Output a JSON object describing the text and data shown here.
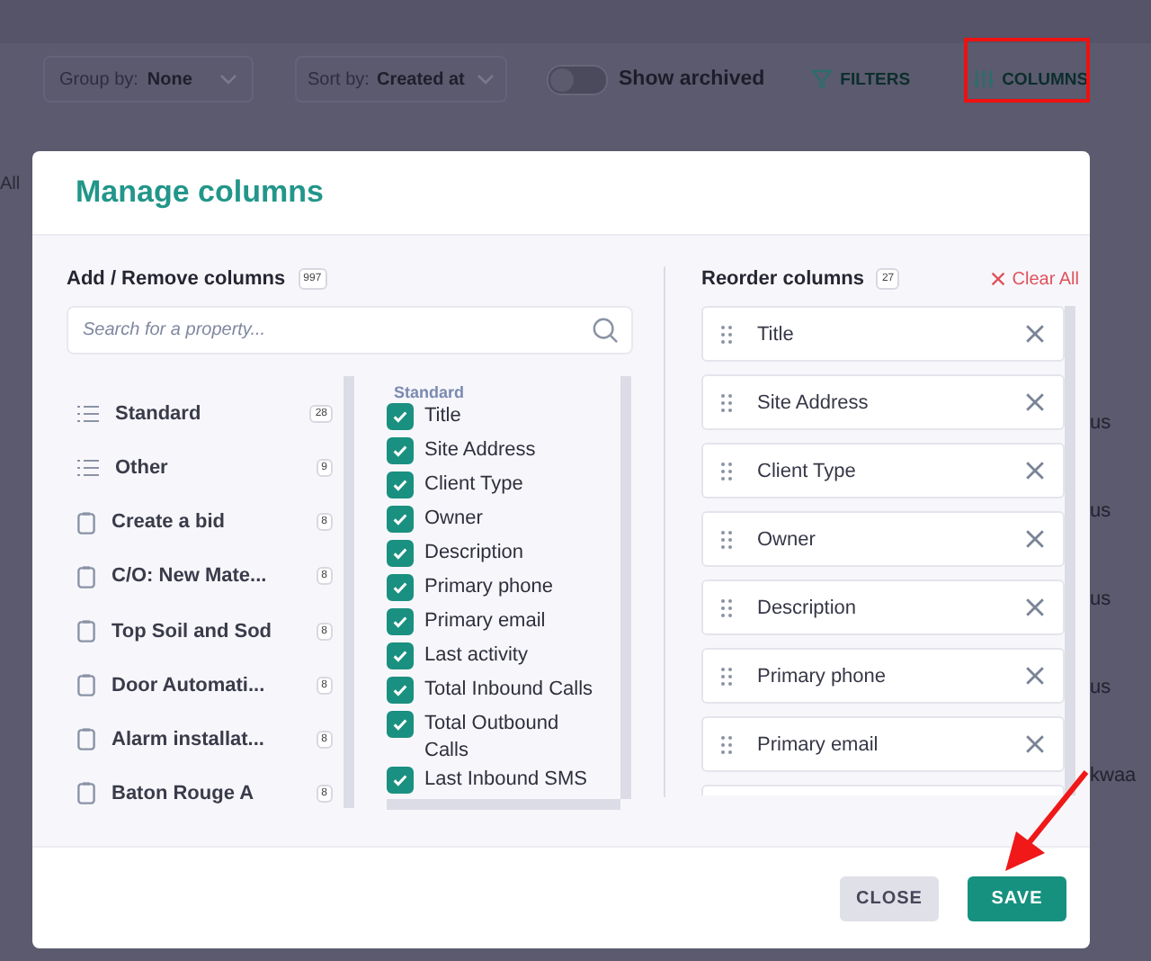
{
  "toolbar": {
    "group_by": {
      "label": "Group by:",
      "value": "None"
    },
    "sort_by": {
      "label": "Sort by:",
      "value": "Created at"
    },
    "show_archived": {
      "label": "Show archived",
      "on": false
    },
    "filters": "FILTERS",
    "columns": "COLUMNS"
  },
  "background_fragments": {
    "left": "All",
    "right": [
      "us",
      "us",
      "us",
      "us",
      "kwaa"
    ]
  },
  "dialog": {
    "title": "Manage columns",
    "add_remove": {
      "heading": "Add / Remove columns",
      "count": "997",
      "search": {
        "placeholder": "Search for a property..."
      },
      "categories": [
        {
          "kind": "list",
          "label": "Standard",
          "count": "28"
        },
        {
          "kind": "list",
          "label": "Other",
          "count": "9"
        },
        {
          "kind": "form",
          "label": "Create a bid",
          "count": "8"
        },
        {
          "kind": "form",
          "label": "C/O: New Mate...",
          "count": "8"
        },
        {
          "kind": "form",
          "label": "Top Soil and Sod",
          "count": "8"
        },
        {
          "kind": "form",
          "label": "Door Automati...",
          "count": "8"
        },
        {
          "kind": "form",
          "label": "Alarm installat...",
          "count": "8"
        },
        {
          "kind": "form",
          "label": "Baton Rouge A",
          "count": "8"
        }
      ],
      "group_heading": "Standard",
      "fields": [
        {
          "label": "Title",
          "checked": true
        },
        {
          "label": "Site Address",
          "checked": true
        },
        {
          "label": "Client Type",
          "checked": true
        },
        {
          "label": "Owner",
          "checked": true
        },
        {
          "label": "Description",
          "checked": true
        },
        {
          "label": "Primary phone",
          "checked": true
        },
        {
          "label": "Primary email",
          "checked": true
        },
        {
          "label": "Last activity",
          "checked": true
        },
        {
          "label": "Total Inbound Calls",
          "checked": true
        },
        {
          "label": "Total Outbound Calls",
          "checked": true
        },
        {
          "label": "Last Inbound SMS",
          "checked": true
        }
      ]
    },
    "reorder": {
      "heading": "Reorder columns",
      "count": "27",
      "clear_all": "Clear All",
      "items": [
        "Title",
        "Site Address",
        "Client Type",
        "Owner",
        "Description",
        "Primary phone",
        "Primary email"
      ]
    },
    "buttons": {
      "close": "CLOSE",
      "save": "SAVE"
    }
  }
}
